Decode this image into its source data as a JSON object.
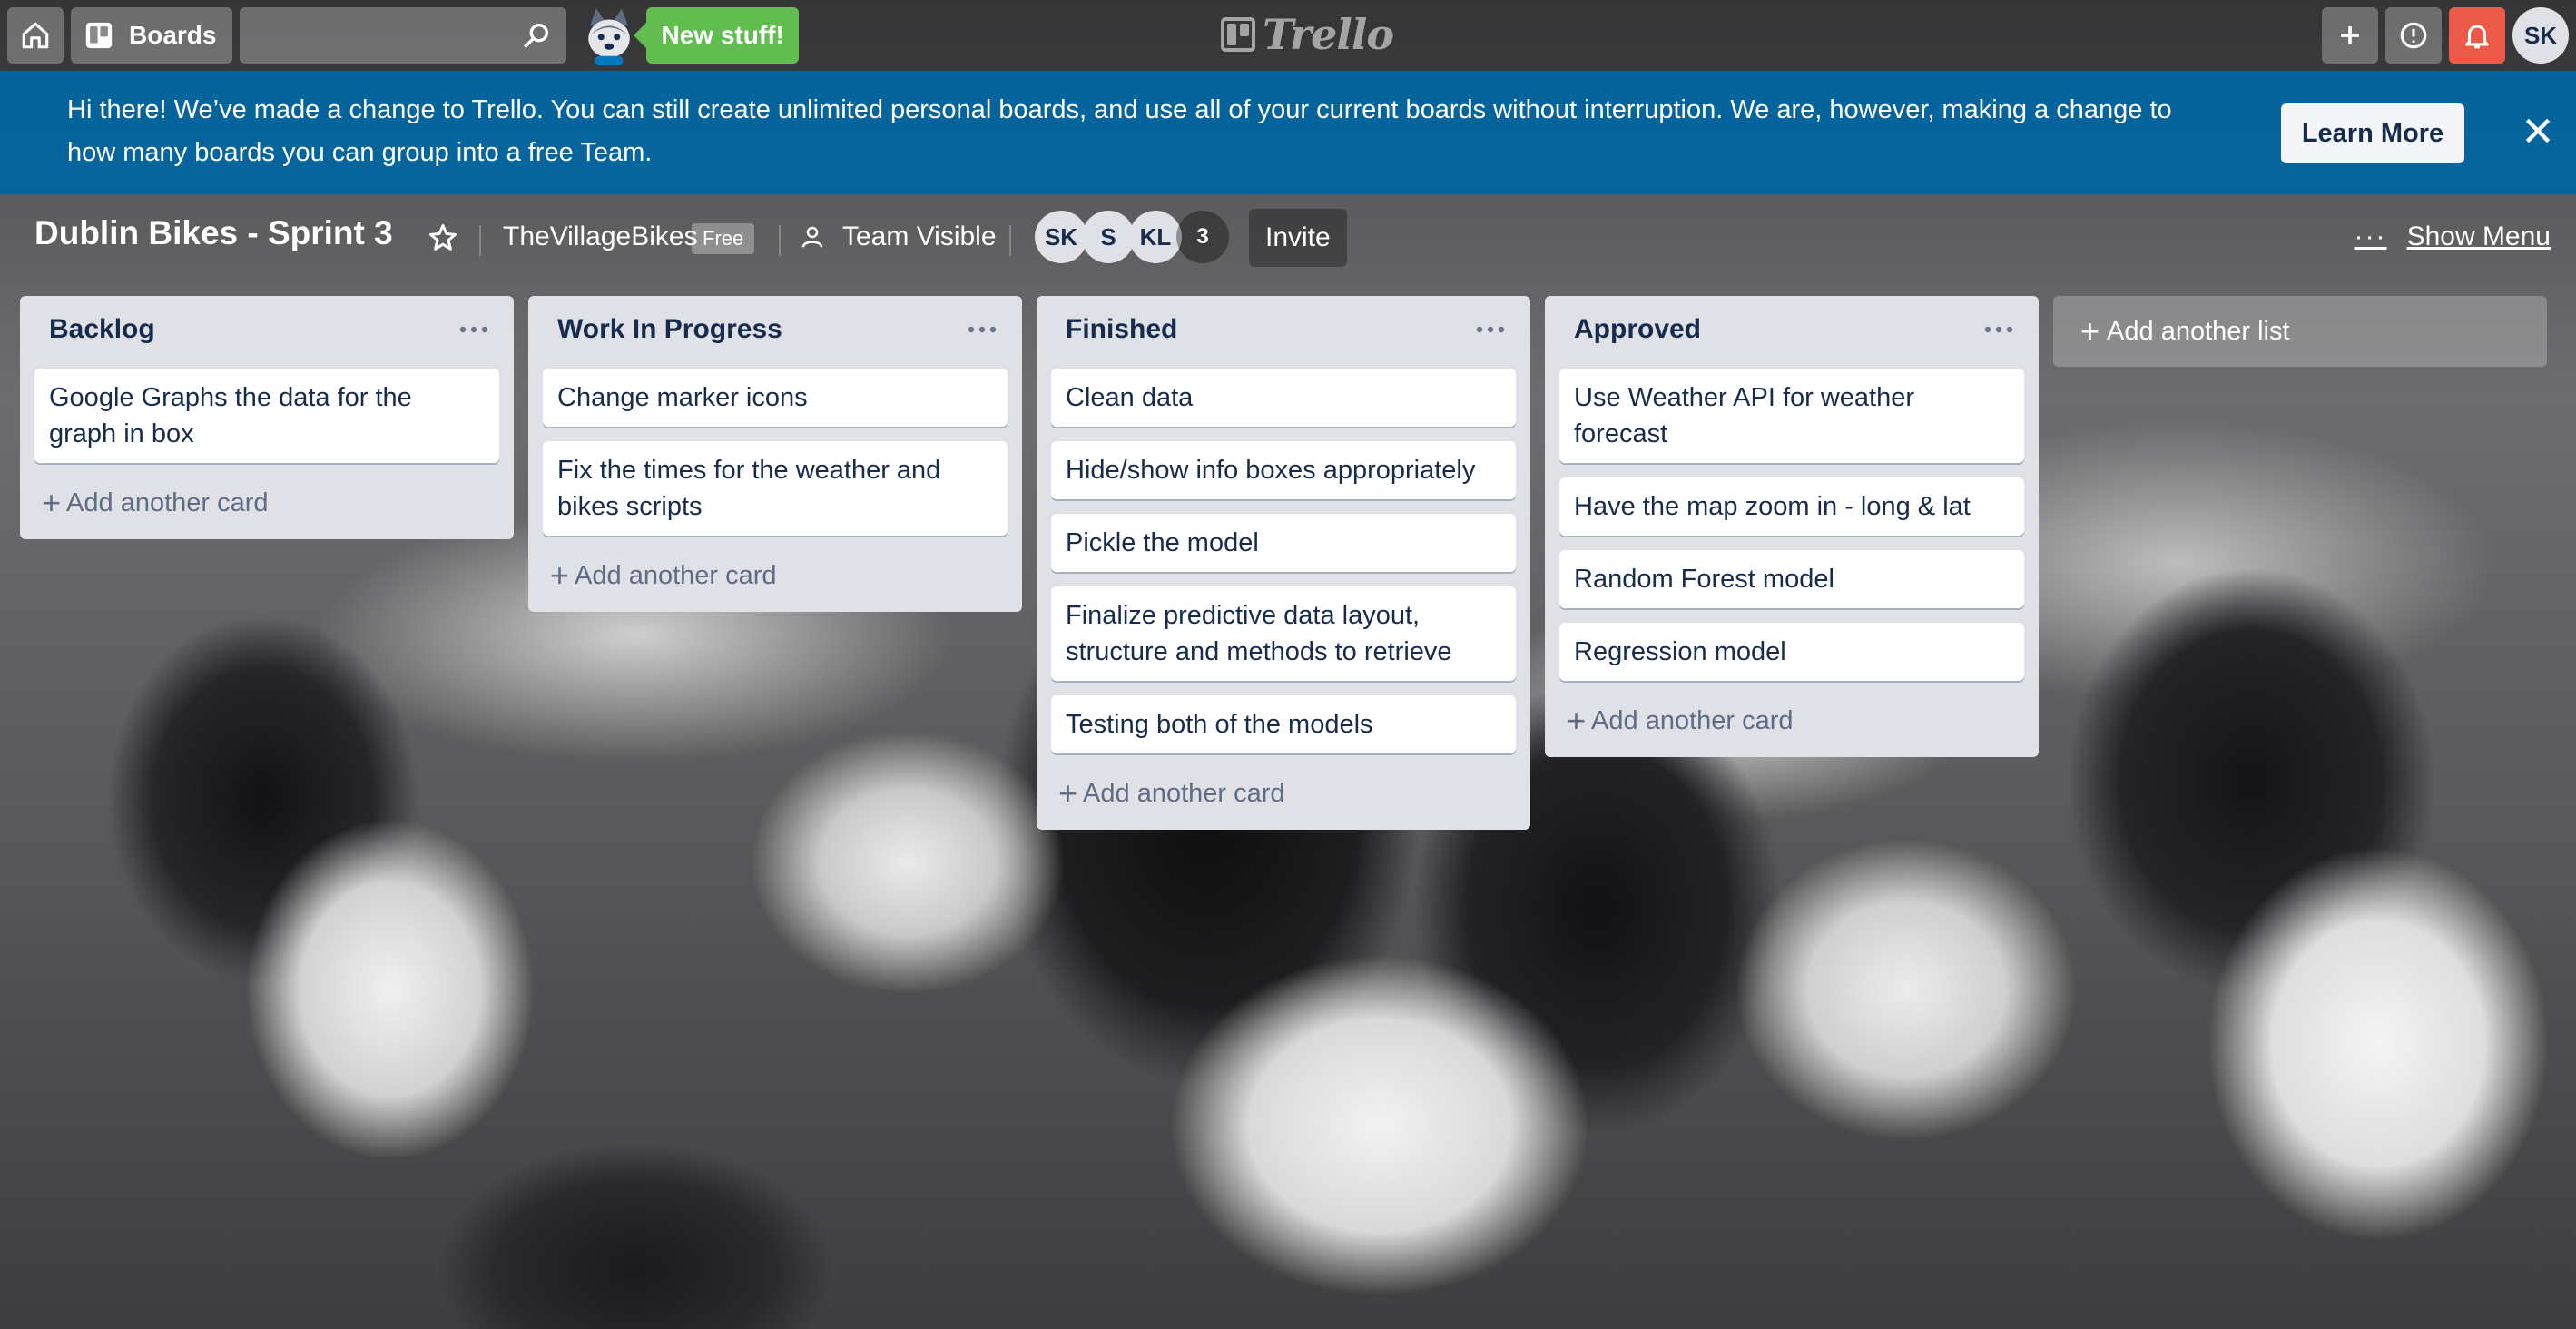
{
  "header": {
    "boards_label": "Boards",
    "new_stuff_label": "New stuff!",
    "logo_text": "Trello",
    "user_initials": "SK"
  },
  "banner": {
    "message": "Hi there! We’ve made a change to Trello. You can still create unlimited personal boards, and use all of your current boards without interruption. We are, however, making a change to how many boards you can group into a free Team.",
    "learn_more_label": "Learn More"
  },
  "board": {
    "title": "Dublin Bikes - Sprint 3",
    "team_name": "TheVillageBikes",
    "plan_badge": "Free",
    "visibility_label": "Team Visible",
    "members": [
      {
        "initials": "SK"
      },
      {
        "initials": "S"
      },
      {
        "initials": "KL"
      }
    ],
    "member_overflow_count": "3",
    "invite_label": "Invite",
    "show_menu_label": "Show Menu"
  },
  "lists": [
    {
      "title": "Backlog",
      "cards": [
        "Google Graphs the data for the graph in box"
      ],
      "add_card_label": "Add another card"
    },
    {
      "title": "Work In Progress",
      "cards": [
        "Change marker icons",
        "Fix the times for the weather and bikes scripts"
      ],
      "add_card_label": "Add another card"
    },
    {
      "title": "Finished",
      "cards": [
        "Clean data",
        "Hide/show info boxes appropriately",
        "Pickle the model",
        "Finalize predictive data layout, structure and methods to retrieve",
        "Testing both of the models"
      ],
      "add_card_label": "Add another card"
    },
    {
      "title": "Approved",
      "cards": [
        "Use Weather API for weather forecast",
        "Have the map zoom in - long & lat",
        "Random Forest model",
        "Regression model"
      ],
      "add_card_label": "Add another card"
    }
  ],
  "add_list_label": "Add another list",
  "colors": {
    "new_stuff_green": "#61bd4f",
    "banner_blue": "#0067a3",
    "notification_red": "#eb5a46",
    "list_bg": "#dfe1e6"
  }
}
